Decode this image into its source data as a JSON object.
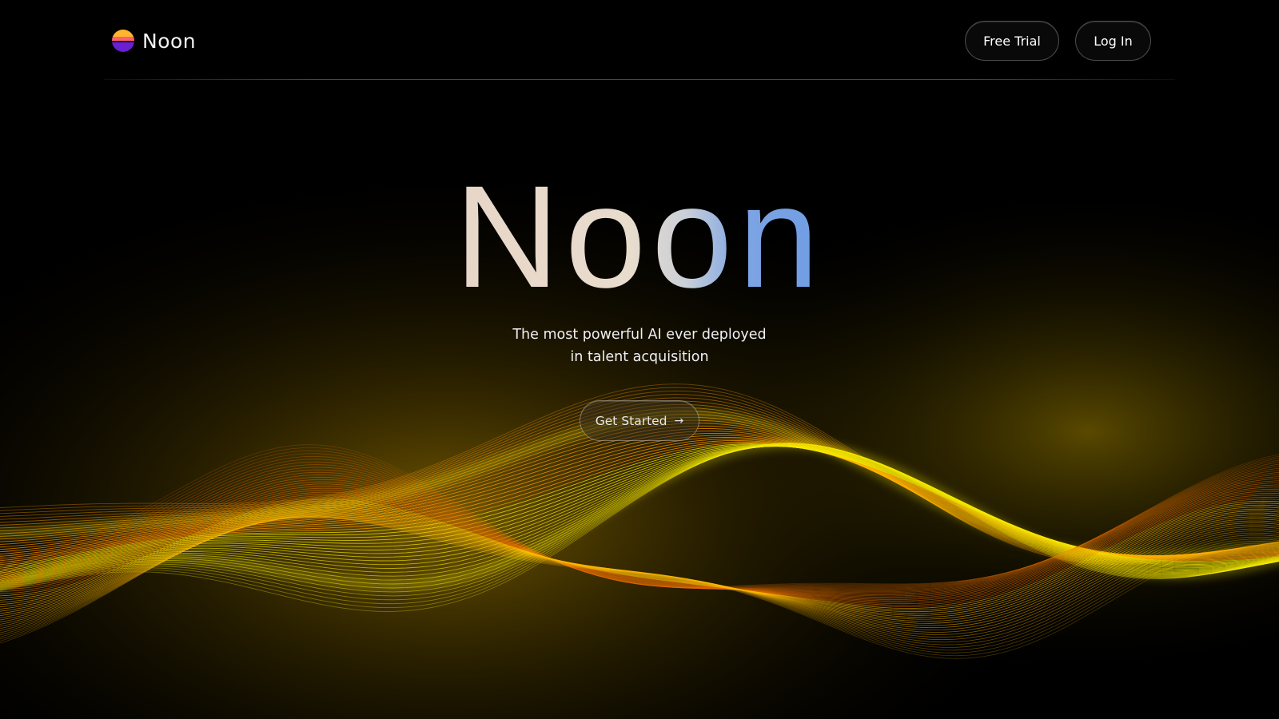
{
  "nav": {
    "brand_name": "Noon",
    "free_trial_label": "Free Trial",
    "login_label": "Log In",
    "logo_icon": "sunset-circle-icon"
  },
  "hero": {
    "title": "Noon",
    "tagline_line1": "The most powerful AI ever deployed",
    "tagline_line2": "in talent acquisition",
    "cta_label": "Get Started",
    "cta_icon": "arrow-right-icon",
    "cta_arrow": "→"
  },
  "colors": {
    "background": "#000000",
    "wave_yellow": "#f5f000",
    "wave_orange": "#e07a00",
    "title_warm": "#e7d6c8",
    "title_blue": "#6d9be4"
  }
}
